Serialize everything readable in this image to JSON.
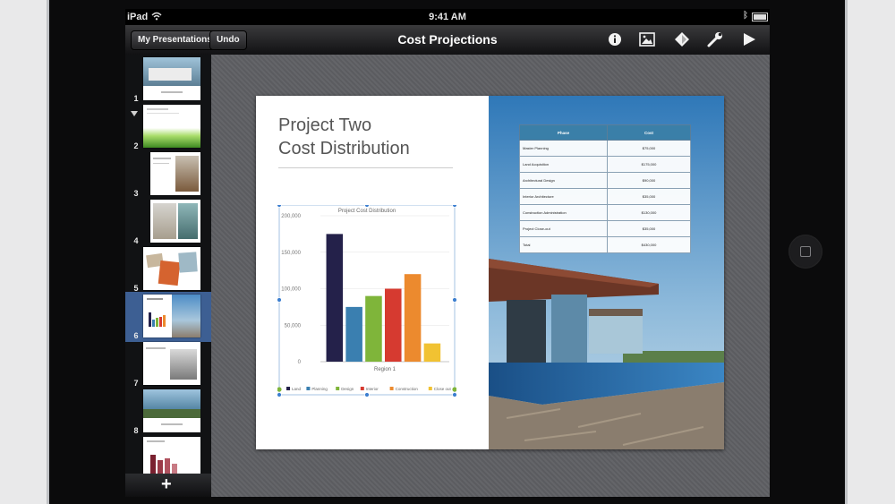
{
  "status": {
    "device": "iPad",
    "time": "9:41 AM"
  },
  "toolbar": {
    "my_presentations": "My Presentations",
    "undo": "Undo",
    "title": "Cost Projections",
    "icons": [
      "info-icon",
      "media-icon",
      "shapes-icon",
      "wrench-icon",
      "play-icon"
    ]
  },
  "navigator": {
    "slides": [
      {
        "number": "1"
      },
      {
        "number": "2"
      },
      {
        "number": "3"
      },
      {
        "number": "4"
      },
      {
        "number": "5"
      },
      {
        "number": "6"
      },
      {
        "number": "7"
      },
      {
        "number": "8"
      }
    ],
    "selected": "6",
    "add_icon": "+"
  },
  "slide": {
    "title_line1": "Project Two",
    "title_line2": "Cost Distribution",
    "table": {
      "headers": [
        "Phase",
        "Cost"
      ],
      "rows": [
        [
          "Master Planning",
          "$75,000"
        ],
        [
          "Land Acquisition",
          "$175,000"
        ],
        [
          "Architectural Design",
          "$90,000"
        ],
        [
          "Interior Architecture",
          "$35,000"
        ],
        [
          "Construction Administration",
          "$130,000"
        ],
        [
          "Project Close-out",
          "$35,000"
        ],
        [
          "Total",
          "$430,000"
        ]
      ]
    }
  },
  "chart_data": {
    "type": "bar",
    "title": "Project Cost Distribution",
    "categories": [
      "Region 1"
    ],
    "xlabel": "Region 1",
    "ylim": [
      0,
      200000
    ],
    "yticks": [
      "0",
      "50,000",
      "100,000",
      "150,000",
      "200,000"
    ],
    "series": [
      {
        "name": "Land",
        "values": [
          175000
        ],
        "color": "#24214a"
      },
      {
        "name": "Planning",
        "values": [
          75000
        ],
        "color": "#3a7fb0"
      },
      {
        "name": "Design",
        "values": [
          90000
        ],
        "color": "#7fb53a"
      },
      {
        "name": "Interior",
        "values": [
          100000
        ],
        "color": "#d63a30"
      },
      {
        "name": "Construction",
        "values": [
          120000
        ],
        "color": "#ec8a2e"
      },
      {
        "name": "Close out",
        "values": [
          25000
        ],
        "color": "#f1c232"
      }
    ]
  }
}
